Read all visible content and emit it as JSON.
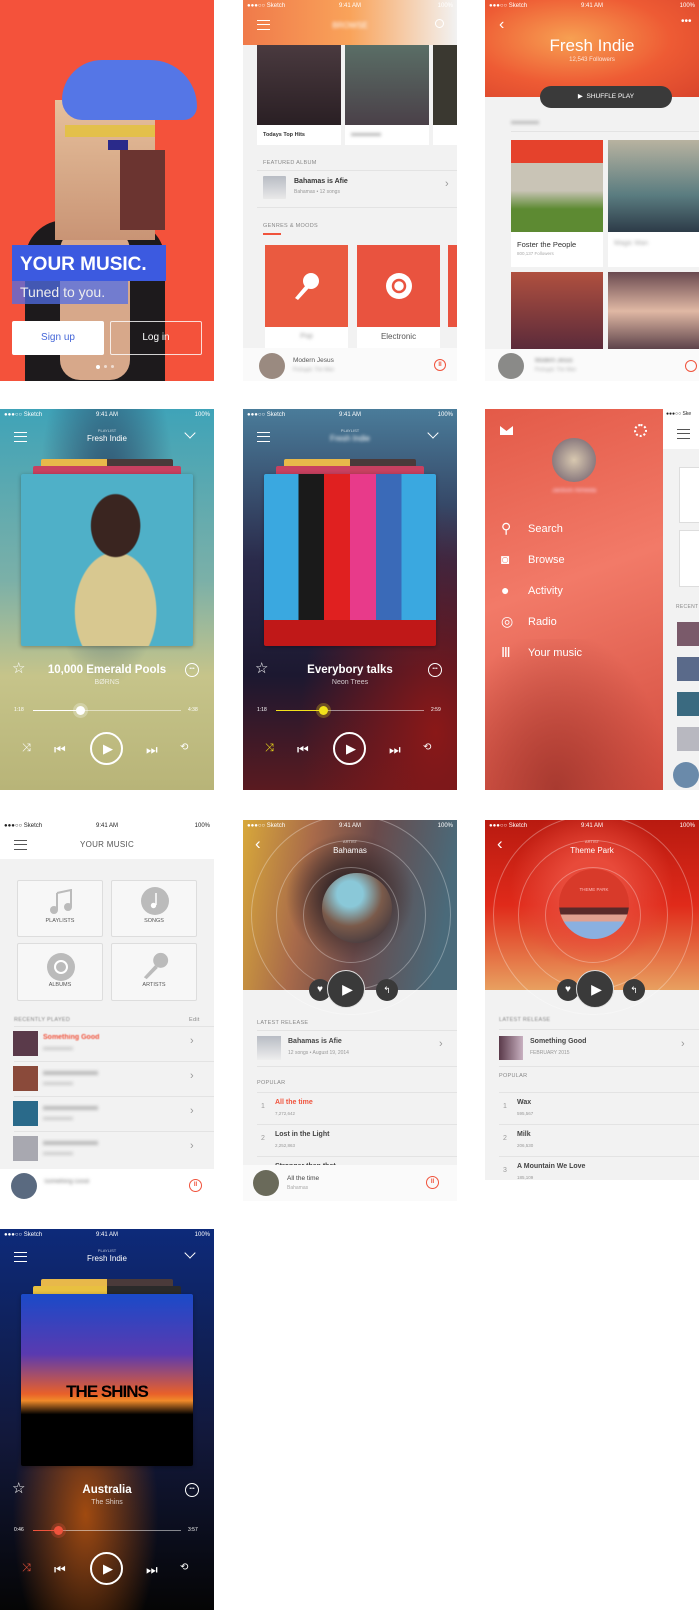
{
  "status_bar": {
    "carrier": "●●●○○ Sketch",
    "time": "9:41 AM",
    "battery": "100%"
  },
  "colors": {
    "brand_red": "#f4523b",
    "shuffle_dark": "#3a3a3a",
    "active_track": "#f0533c"
  },
  "onboarding": {
    "headline": "YOUR MUSIC.",
    "tagline": "Tuned to you.",
    "signup": "Sign up",
    "login": "Log in",
    "page_index": 1,
    "page_count": 3
  },
  "browse": {
    "title": "BROWSE",
    "playlists": [
      {
        "label": "Todays Top Hits"
      }
    ],
    "featured_label": "FEATURED ALBUM",
    "featured": {
      "title": "Bahamas is Afie",
      "subtitle": "Bahamas • 12 songs"
    },
    "genres_label": "GENRES & MOODS",
    "genres": [
      {
        "label": "Pop",
        "icon": "microphone-icon"
      },
      {
        "label": "Electronic",
        "icon": "disc-icon"
      }
    ],
    "now_playing": {
      "title": "Modern Jesus",
      "artist": "Portugal. The Man"
    }
  },
  "playlist": {
    "title": "Fresh Indie",
    "followers": "12,543 Followers",
    "shuffle": "SHUFFLE PLAY",
    "artists": [
      {
        "name": "Foster the People",
        "followers": "800,137 Followers"
      },
      {
        "name": "Magic Man",
        "followers": ""
      }
    ],
    "now_playing": {
      "title": "Modern Jesus",
      "artist": "Portugal. The Man"
    }
  },
  "menu": {
    "user": "Jardson Almeida",
    "items": [
      {
        "label": "Search",
        "icon": "search-icon"
      },
      {
        "label": "Browse",
        "icon": "browse-icon"
      },
      {
        "label": "Activity",
        "icon": "user-icon"
      },
      {
        "label": "Radio",
        "icon": "radio-icon"
      },
      {
        "label": "Your music",
        "icon": "library-icon"
      }
    ],
    "peek_label": "RECENT"
  },
  "your_music": {
    "title": "YOUR MUSIC",
    "tiles": [
      {
        "label": "PLAYLISTS",
        "icon": "music-note-icon"
      },
      {
        "label": "SONGS",
        "icon": "song-icon"
      },
      {
        "label": "ALBUMS",
        "icon": "album-icon"
      },
      {
        "label": "ARTISTS",
        "icon": "microphone-icon"
      }
    ],
    "recent_label": "RECENTLY PLAYED",
    "edit": "Edit",
    "recent": [
      {
        "title": "Something Good"
      },
      {
        "title": ""
      },
      {
        "title": ""
      },
      {
        "title": ""
      }
    ],
    "now_playing": {
      "title": "Something Good"
    }
  },
  "players": [
    {
      "playlist_label": "PLAYLIST",
      "playlist": "Fresh Indie",
      "title": "10,000 Emerald Pools",
      "artist": "BØRNS",
      "elapsed": "1:18",
      "duration": "4:38",
      "progress": 0.32,
      "accent": "#ffffff"
    },
    {
      "playlist_label": "PLAYLIST",
      "playlist": "Fresh Indie",
      "title": "Everybory talks",
      "artist": "Neon Trees",
      "elapsed": "1:18",
      "duration": "2:59",
      "progress": 0.32,
      "accent": "#f2e21b"
    },
    {
      "playlist_label": "PLAYLIST",
      "playlist": "Fresh Indie",
      "title": "Australia",
      "artist": "The Shins",
      "elapsed": "0:46",
      "duration": "3:57",
      "progress": 0.17,
      "accent": "#f0533c",
      "cover_text": "THE SHINS"
    }
  ],
  "artists": [
    {
      "label": "ARTIST",
      "name": "Bahamas",
      "release_label": "LATEST RELEASE",
      "release": {
        "title": "Bahamas is Afie",
        "subtitle": "12 songs • August 19, 2014"
      },
      "popular_label": "POPULAR",
      "tracks": [
        {
          "n": "1",
          "title": "All the time",
          "plays": "7,272,642",
          "active": true
        },
        {
          "n": "2",
          "title": "Lost in the Light",
          "plays": "2,252,863"
        },
        {
          "n": "3",
          "title": "Stronger than that",
          "plays": ""
        }
      ],
      "now_playing": {
        "title": "All the time",
        "artist": "Bahamas"
      }
    },
    {
      "label": "ARTIST",
      "name": "Theme Park",
      "cover_text": "THEME PARK",
      "release_label": "LATEST RELEASE",
      "release": {
        "title": "Something Good",
        "subtitle": "FEBRUARY 2015"
      },
      "popular_label": "POPULAR",
      "tracks": [
        {
          "n": "1",
          "title": "Wax",
          "plays": "595,567"
        },
        {
          "n": "2",
          "title": "Milk",
          "plays": "206,530"
        },
        {
          "n": "3",
          "title": "A Mountain We Love",
          "plays": "185,109"
        }
      ]
    }
  ]
}
